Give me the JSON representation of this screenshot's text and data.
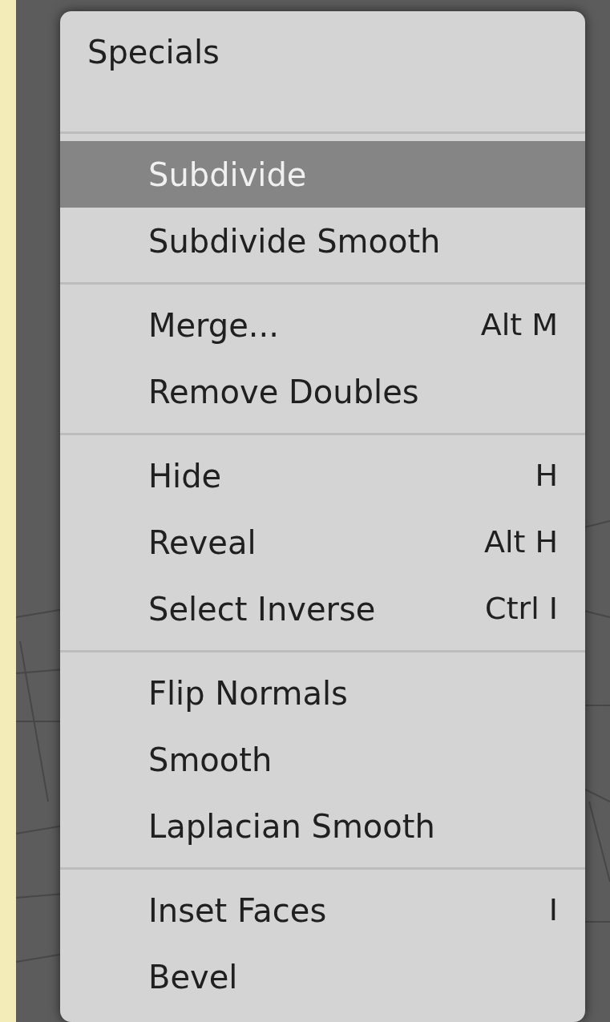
{
  "menu": {
    "title": "Specials",
    "sections": [
      [
        {
          "label": "Subdivide",
          "selected": true
        },
        {
          "label": "Subdivide Smooth",
          "selected": false
        }
      ],
      [
        {
          "label": "Merge...",
          "shortcut": "Alt M",
          "selected": false
        },
        {
          "label": "Remove Doubles",
          "selected": false
        }
      ],
      [
        {
          "label": "Hide",
          "shortcut": "H",
          "selected": false
        },
        {
          "label": "Reveal",
          "shortcut": "Alt H",
          "selected": false
        },
        {
          "label": "Select Inverse",
          "shortcut": "Ctrl I",
          "selected": false
        }
      ],
      [
        {
          "label": "Flip Normals",
          "selected": false
        },
        {
          "label": "Smooth",
          "selected": false
        },
        {
          "label": "Laplacian Smooth",
          "selected": false
        }
      ],
      [
        {
          "label": "Inset Faces",
          "shortcut": "I",
          "selected": false
        },
        {
          "label": "Bevel",
          "selected": false
        }
      ]
    ]
  }
}
